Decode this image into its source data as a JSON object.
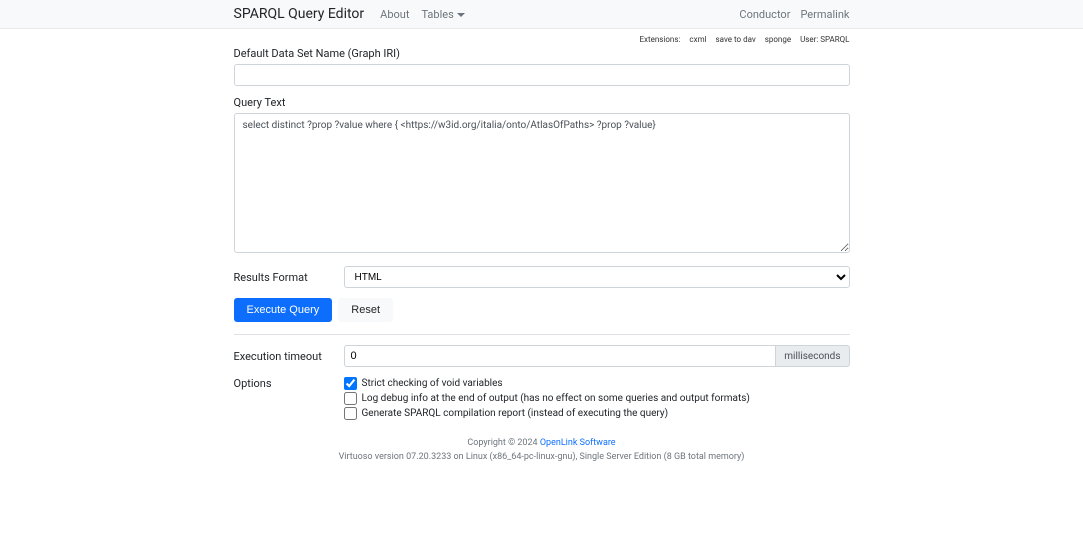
{
  "nav": {
    "brand": "SPARQL Query Editor",
    "about": "About",
    "tables": "Tables",
    "conductor": "Conductor",
    "permalink": "Permalink"
  },
  "subnav": {
    "extensions": "Extensions:",
    "cxml": "cxml",
    "save_to_dav": "save to dav",
    "sponge": "sponge",
    "user": "User: SPARQL"
  },
  "labels": {
    "graph_iri": "Default Data Set Name (Graph IRI)",
    "query_text": "Query Text",
    "results_format": "Results Format",
    "exec_timeout": "Execution timeout",
    "options": "Options",
    "ms": "milliseconds"
  },
  "form": {
    "graph_value": "",
    "query_value": "select distinct ?prop ?value where { <https://w3id.org/italia/onto/AtlasOfPaths> ?prop ?value}",
    "format_selected": "HTML",
    "timeout_value": "0"
  },
  "buttons": {
    "execute": "Execute Query",
    "reset": "Reset"
  },
  "options": {
    "strict": {
      "label": "Strict checking of void variables",
      "checked": true
    },
    "log_debug": {
      "label": "Log debug info at the end of output (has no effect on some queries and output formats)",
      "checked": false
    },
    "compile": {
      "label": "Generate SPARQL compilation report (instead of executing the query)",
      "checked": false
    }
  },
  "footer": {
    "copyright_pre": "Copyright © 2024 ",
    "openlink": "OpenLink Software",
    "version": "Virtuoso version 07.20.3233 on Linux (x86_64-pc-linux-gnu), Single Server Edition (8 GB total memory)"
  }
}
